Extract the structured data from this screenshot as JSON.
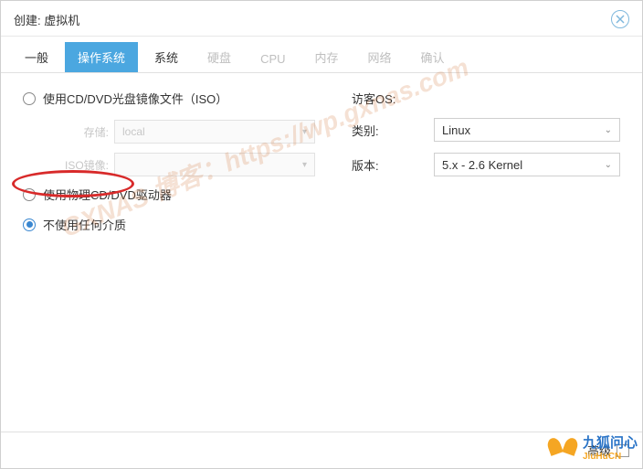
{
  "dialog": {
    "title": "创建: 虚拟机"
  },
  "tabs": {
    "general": "一般",
    "os": "操作系统",
    "system": "系统",
    "disk": "硬盘",
    "cpu": "CPU",
    "memory": "内存",
    "network": "网络",
    "confirm": "确认"
  },
  "media": {
    "iso_label": "使用CD/DVD光盘镜像文件（ISO）",
    "storage_label": "存储:",
    "storage_value": "local",
    "isoimg_label": "ISO镜像:",
    "isoimg_value": "",
    "physical_label": "使用物理CD/DVD驱动器",
    "none_label": "不使用任何介质"
  },
  "guest": {
    "os_label": "访客OS:",
    "type_label": "类别:",
    "type_value": "Linux",
    "version_label": "版本:",
    "version_value": "5.x - 2.6 Kernel"
  },
  "footer": {
    "advanced": "高级"
  },
  "watermark": "GXNAS 博客：https://wp.gxnas.com",
  "brand": {
    "cn": "九狐问心",
    "en": "JiuHuCN"
  }
}
